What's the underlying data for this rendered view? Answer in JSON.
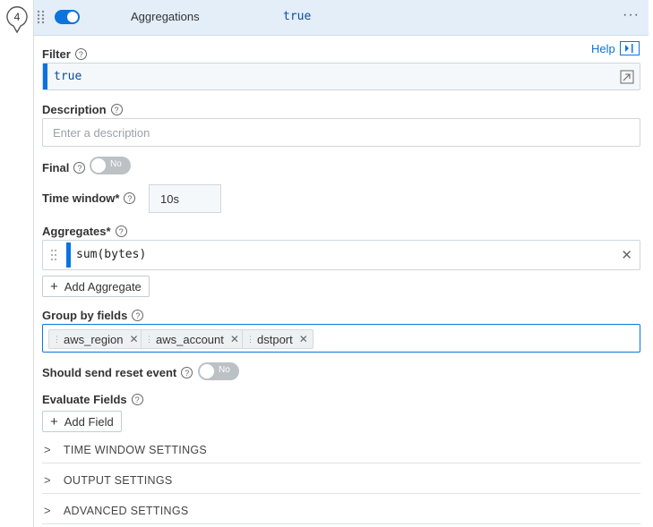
{
  "step": {
    "number": "4"
  },
  "header": {
    "title": "Aggregations",
    "filter_expr": "true",
    "enabled": true,
    "more_icon": "more-horizontal-icon"
  },
  "help": {
    "label": "Help"
  },
  "filter": {
    "label": "Filter",
    "value": "true"
  },
  "description": {
    "label": "Description",
    "placeholder": "Enter a description",
    "value": ""
  },
  "final": {
    "label": "Final",
    "toggle_text": "No"
  },
  "time_window": {
    "label": "Time window*",
    "value": "10s"
  },
  "aggregates": {
    "label": "Aggregates*",
    "items": [
      "sum(bytes)"
    ],
    "add_label": "Add Aggregate"
  },
  "group_by": {
    "label": "Group by fields",
    "chips": [
      "aws_region",
      "aws_account",
      "dstport"
    ]
  },
  "reset_event": {
    "label": "Should send reset event",
    "toggle_text": "No"
  },
  "evaluate": {
    "label": "Evaluate Fields",
    "add_label": "Add Field"
  },
  "sections": [
    "TIME WINDOW SETTINGS",
    "OUTPUT SETTINGS",
    "ADVANCED SETTINGS"
  ],
  "colors": {
    "accent": "#0b74de",
    "header_bg": "#e3eef9"
  }
}
